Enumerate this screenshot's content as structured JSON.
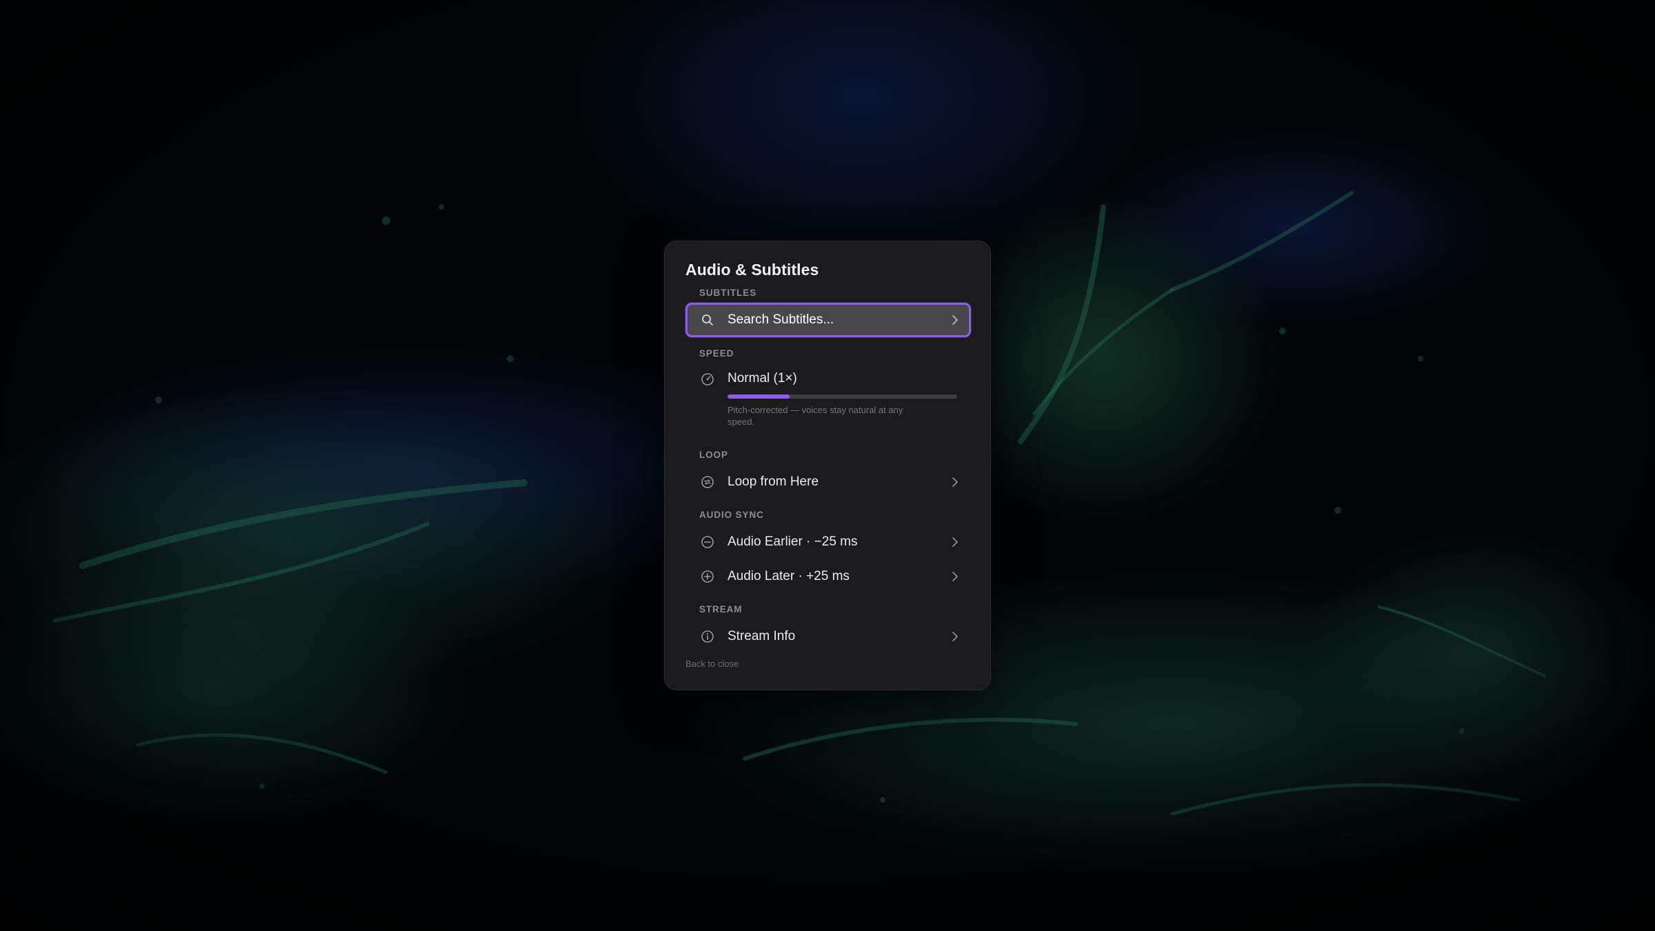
{
  "panel": {
    "title": "Audio & Subtitles",
    "footer_hint": "Back to close"
  },
  "subtitles": {
    "section_label": "SUBTITLES",
    "search_label": "Search Subtitles...",
    "search_icon": "search-icon",
    "focused": true
  },
  "speed": {
    "section_label": "SPEED",
    "current_label": "Normal (1×)",
    "icon": "speedometer-icon",
    "progress_fraction": 0.27,
    "note": "Pitch-corrected — voices stay natural at any speed."
  },
  "loop": {
    "section_label": "LOOP",
    "item_label": "Loop from Here",
    "icon": "loop-icon"
  },
  "audio_sync": {
    "section_label": "AUDIO SYNC",
    "items": [
      {
        "label": "Audio Earlier · −25 ms",
        "icon": "minus-circle-icon"
      },
      {
        "label": "Audio Later · +25 ms",
        "icon": "plus-circle-icon"
      }
    ]
  },
  "stream": {
    "section_label": "STREAM",
    "item_label": "Stream Info",
    "icon": "info-icon"
  },
  "colors": {
    "accent": "#8a5cf0",
    "panel_bg": "#1b1b1d",
    "focused_row_bg": "#47474b",
    "text_primary": "#ececef",
    "text_secondary": "#8d8d93"
  }
}
